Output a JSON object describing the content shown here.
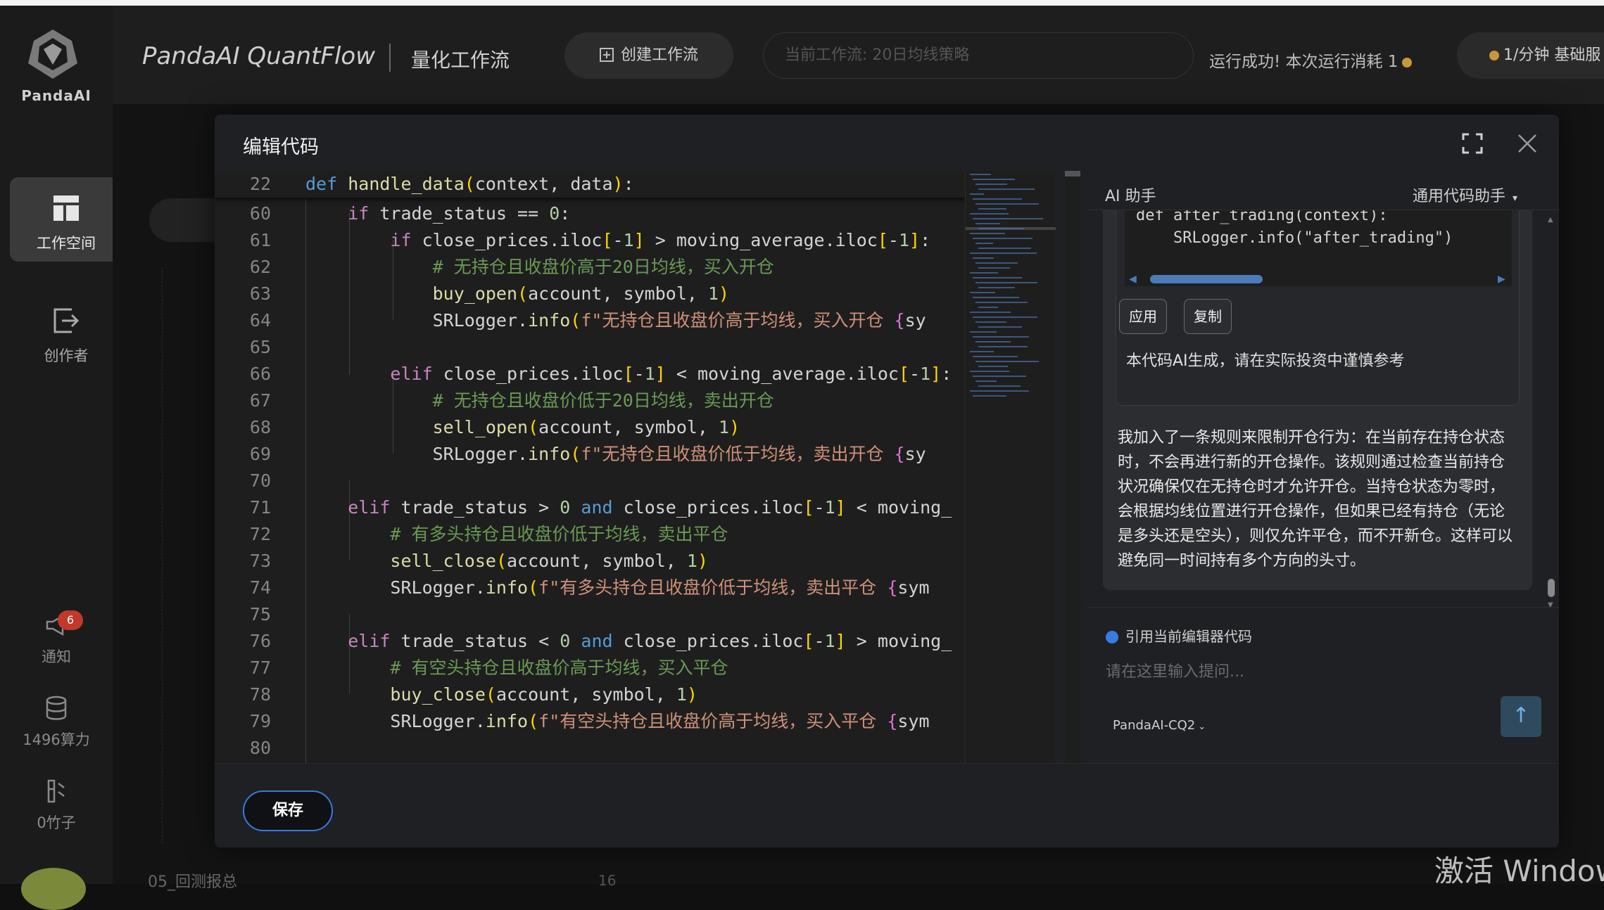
{
  "sidebar": {
    "logo_text": "PandaAI",
    "workspace_label": "工作空间",
    "creator_label": "创作者",
    "notify_label": "通知",
    "notify_count": "6",
    "compute_label": "1496算力",
    "bamboo_label": "0竹子"
  },
  "header": {
    "brand": "PandaAI QuantFlow",
    "brand_sub": "量化工作流",
    "create_label": "创建工作流",
    "current_workflow": "当前工作流:  20日均线策略",
    "run_status": "运行成功!  本次运行消耗 1",
    "rate_label": "1/分钟  基础服"
  },
  "background": {
    "footer_text": "05_回测报总",
    "footer_num": "16"
  },
  "modal": {
    "title": "编辑代码",
    "save_label": "保存"
  },
  "editor": {
    "sticky_line_number": "22",
    "line_numbers": [
      "60",
      "61",
      "62",
      "63",
      "64",
      "65",
      "66",
      "67",
      "68",
      "69",
      "70",
      "71",
      "72",
      "73",
      "74",
      "75",
      "76",
      "77",
      "78",
      "79",
      "80"
    ]
  },
  "ai": {
    "title": "AI 助手",
    "mode": "通用代码助手",
    "snippet_line1": "def after_trading(context):",
    "snippet_line2": "    SRLogger.info(\"after_trading\")",
    "apply_label": "应用",
    "copy_label": "复制",
    "disclaimer": "本代码AI生成，请在实际投资中谨慎参考",
    "message": "我加入了一条规则来限制开仓行为：在当前存在持仓状态时，不会再进行新的开仓操作。该规则通过检查当前持仓状况确保仅在无持仓时才允许开仓。当持仓状态为零时，会根据均线位置进行开仓操作，但如果已经有持仓（无论是多头还是空头），则仅允许平仓，而不开新仓。这样可以避免同一时间持有多个方向的头寸。",
    "ref_label": "引用当前编辑器代码",
    "input_placeholder": "请在这里输入提问...",
    "model": "PandaAI-CQ2"
  },
  "watermark": "激活 Windows"
}
